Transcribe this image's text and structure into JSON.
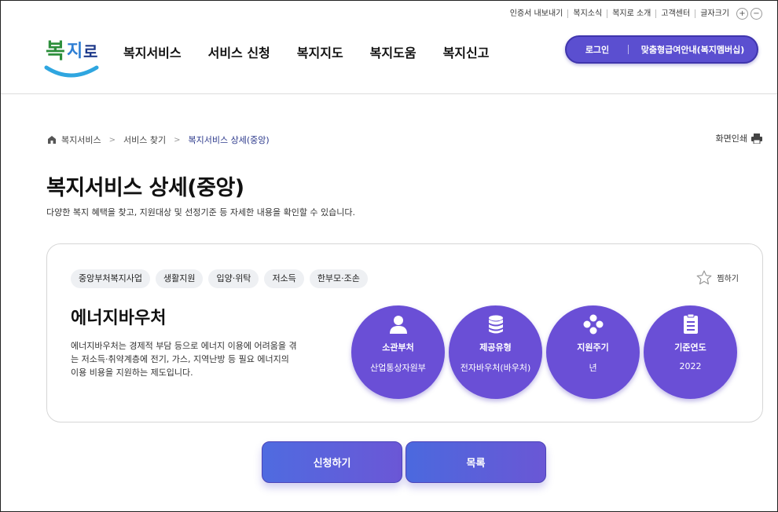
{
  "util": {
    "links": [
      "인증서 내보내기",
      "복지소식",
      "복지로 소개",
      "고객센터",
      "글자크기"
    ],
    "font_plus": "+",
    "font_minus": "−"
  },
  "logo": {
    "text": "복지로"
  },
  "gnb": [
    "복지서비스",
    "서비스 신청",
    "복지지도",
    "복지도움",
    "복지신고"
  ],
  "header": {
    "login_label": "로그인",
    "member_label": "맞춤형급여안내(복지멤버십)"
  },
  "breadcrumb": {
    "items": [
      "복지서비스",
      "서비스 찾기",
      "복지서비스 상세(중앙)"
    ]
  },
  "print_label": "화면인쇄",
  "page_title": "복지서비스 상세(중앙)",
  "page_desc": "다양한 복지 혜택을 찾고, 지원대상 및 선정기준 등 자세한 내용을 확인할 수 있습니다.",
  "service": {
    "tags": [
      "중앙부처복지사업",
      "생활지원",
      "입양·위탁",
      "저소득",
      "한부모·조손"
    ],
    "fav_label": "찜하기",
    "name": "에너지바우처",
    "description": "에너지바우처는 경제적 부담 등으로 에너지 이용에 어려움을 겪는 저소득·취약계층에 전기, 가스, 지역난방 등 필요 에너지의 이용 비용을 지원하는 제도입니다.",
    "info": [
      {
        "label": "소관부처",
        "value": "산업통상자원부",
        "icon": "person-icon"
      },
      {
        "label": "제공유형",
        "value": "전자바우처(바우처)",
        "icon": "coin-stack-icon"
      },
      {
        "label": "지원주기",
        "value": "년",
        "icon": "cycle-dots-icon"
      },
      {
        "label": "기준연도",
        "value": "2022",
        "icon": "document-list-icon"
      }
    ]
  },
  "buttons": {
    "apply": "신청하기",
    "list": "목록"
  },
  "colors": {
    "accent": "#6a4fd6",
    "pill": "#5b4fd0",
    "crumb_current": "#2d3a8c"
  }
}
